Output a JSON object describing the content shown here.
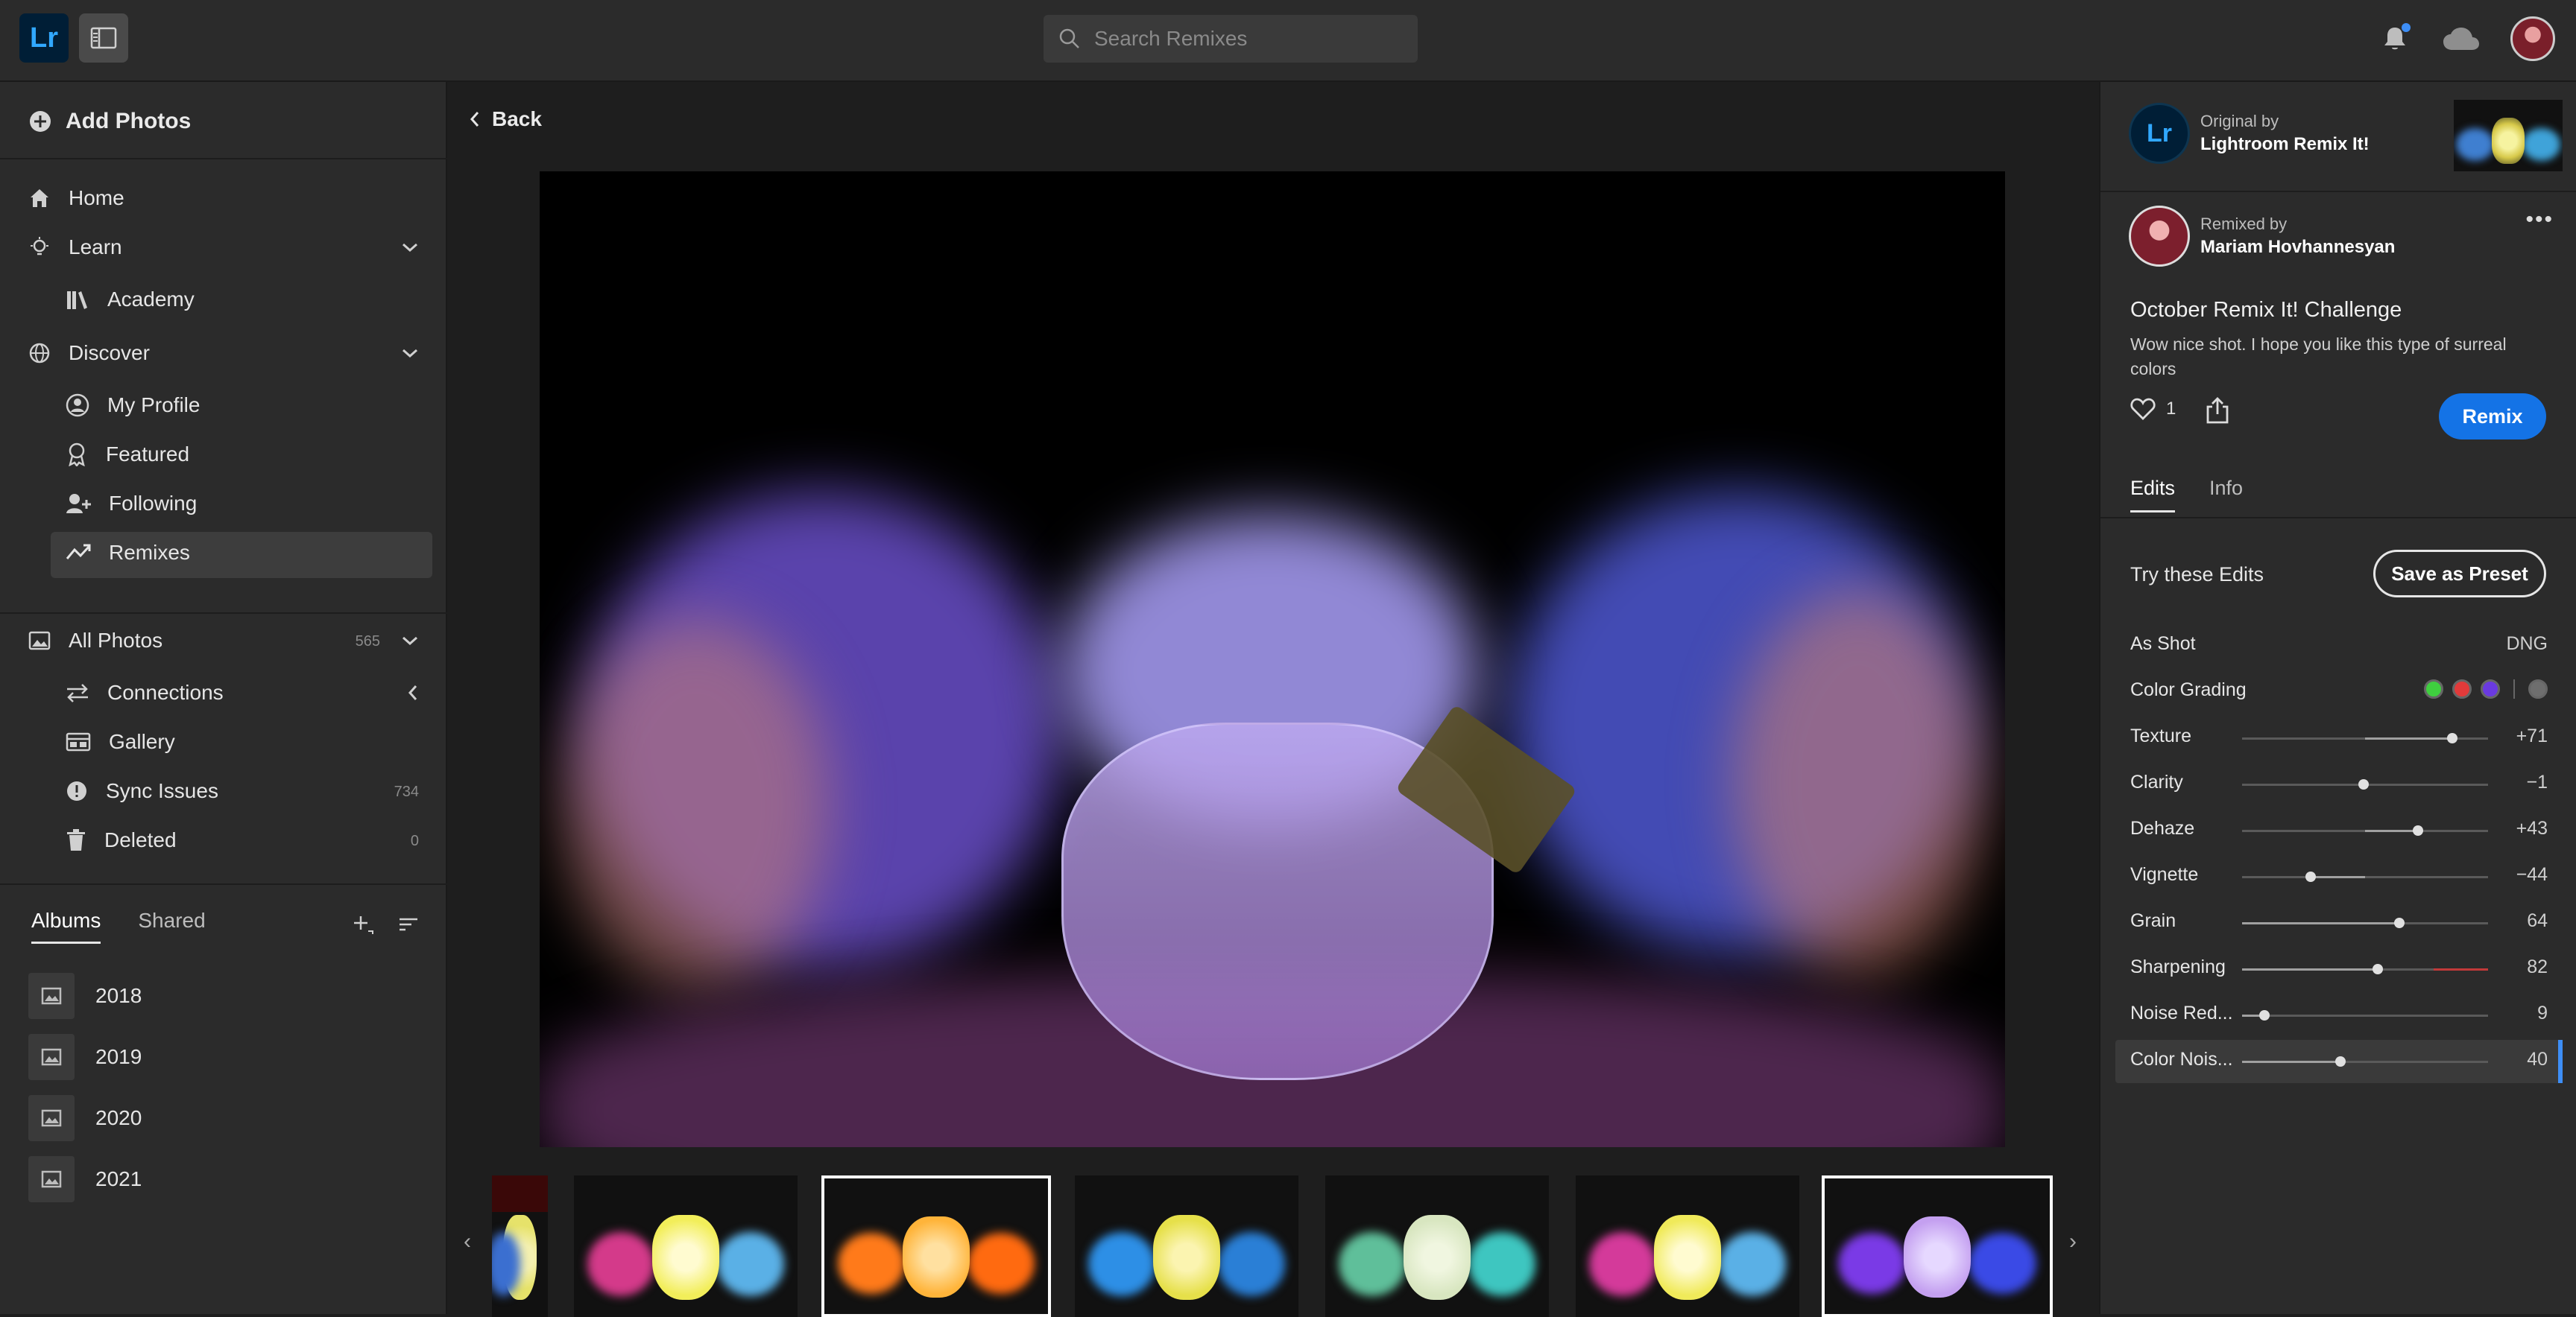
{
  "app": {
    "logo_text": "Lr"
  },
  "search": {
    "placeholder": "Search Remixes"
  },
  "sidebar": {
    "add_photos": "Add Photos",
    "nav": {
      "home": "Home",
      "learn": "Learn",
      "academy": "Academy",
      "discover": "Discover",
      "my_profile": "My Profile",
      "featured": "Featured",
      "following": "Following",
      "remixes": "Remixes",
      "all_photos": "All Photos",
      "all_photos_count": "565",
      "connections": "Connections",
      "gallery": "Gallery",
      "sync_issues": "Sync Issues",
      "sync_issues_count": "734",
      "deleted": "Deleted",
      "deleted_count": "0"
    },
    "album_tabs": {
      "albums": "Albums",
      "shared": "Shared"
    },
    "albums": [
      "2018",
      "2019",
      "2020",
      "2021"
    ]
  },
  "main": {
    "back_label": "Back"
  },
  "filmstrip": {
    "thumbs": [
      {
        "left": "#3b6fd0",
        "center": "#e6e26a",
        "right": "#d8d04a",
        "partial": true
      },
      {
        "left": "#d43a8a",
        "center": "#f2ee5a",
        "right": "#5ab0e6",
        "partial": false
      },
      {
        "left": "#ff7a1a",
        "center": "#ffb43a",
        "right": "#ff6a10",
        "partial": false
      },
      {
        "left": "#2d8fe6",
        "center": "#e6e04a",
        "right": "#2a7fd6",
        "partial": false
      },
      {
        "left": "#5fbf9a",
        "center": "#d8e6c0",
        "right": "#3ec6c0",
        "partial": false
      },
      {
        "left": "#d43a9a",
        "center": "#f0ea5a",
        "right": "#5ab0e6",
        "partial": false
      },
      {
        "left": "#7a3ae6",
        "center": "#c4a0f0",
        "right": "#3a4ae6",
        "partial": false
      }
    ],
    "selected": [
      2,
      6
    ]
  },
  "right_panel": {
    "original_by_label": "Original by",
    "original_by_name": "Lightroom Remix It!",
    "original_logo": "Lr",
    "remixed_by_label": "Remixed by",
    "remixed_by_name": "Mariam Hovhannesyan",
    "more_label": "•••",
    "challenge_title": "October Remix It! Challenge",
    "comment": "Wow nice shot. I hope you like this type of surreal colors",
    "likes": "1",
    "remix_button": "Remix",
    "tabs": {
      "edits": "Edits",
      "info": "Info"
    },
    "try_edits": "Try these Edits",
    "save_preset": "Save as Preset",
    "as_shot": {
      "label": "As Shot",
      "value": "DNG"
    },
    "color_grading": {
      "label": "Color Grading",
      "dots": [
        "#3fcf3f",
        "#e23a3a",
        "#6a3ae0",
        "#6e6e6e"
      ]
    },
    "edits": [
      {
        "label": "Texture",
        "value": "+71",
        "pos": 0.855,
        "from": 0.5
      },
      {
        "label": "Clarity",
        "value": "−1",
        "pos": 0.495,
        "from": 0.5
      },
      {
        "label": "Dehaze",
        "value": "+43",
        "pos": 0.715,
        "from": 0.5
      },
      {
        "label": "Vignette",
        "value": "−44",
        "pos": 0.28,
        "from": 0.5
      },
      {
        "label": "Grain",
        "value": "64",
        "pos": 0.64,
        "from": 0.0
      },
      {
        "label": "Sharpening",
        "value": "82",
        "pos": 0.55,
        "from": 0.0,
        "accent": "#c23a3a"
      },
      {
        "label": "Noise Red...",
        "value": "9",
        "pos": 0.09,
        "from": 0.0
      },
      {
        "label": "Color Nois...",
        "value": "40",
        "pos": 0.4,
        "from": 0.0
      }
    ]
  }
}
